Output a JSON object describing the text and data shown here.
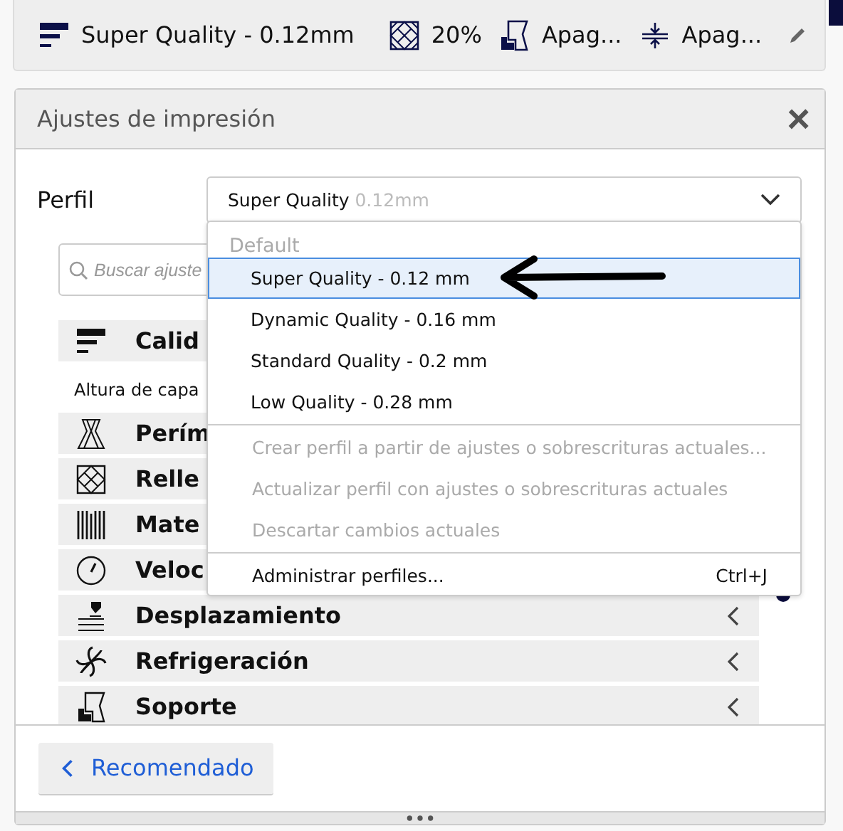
{
  "top_bar": {
    "profile": "Super Quality - 0.12mm",
    "infill": "20%",
    "support": "Apag...",
    "adhesion": "Apag..."
  },
  "panel": {
    "title": "Ajustes de impresión",
    "close": "×",
    "profile_label": "Perfil",
    "profile_combo": {
      "value": "Super Quality",
      "detail": "0.12mm"
    },
    "search": {
      "placeholder": "Buscar ajuste"
    },
    "categories": [
      {
        "name": "Calid",
        "settings": [
          {
            "label": "Altura de capa"
          }
        ]
      },
      {
        "name": "Perím"
      },
      {
        "name": "Relle"
      },
      {
        "name": "Mate"
      },
      {
        "name": "Veloc"
      },
      {
        "name": "Desplazamiento"
      },
      {
        "name": "Refrigeración"
      },
      {
        "name": "Soporte"
      }
    ],
    "footer_button": "Recomendado"
  },
  "dropdown": {
    "header": "Default",
    "profiles": [
      {
        "label": "Super Quality - 0.12 mm",
        "selected": true
      },
      {
        "label": "Dynamic Quality - 0.16 mm",
        "selected": false
      },
      {
        "label": "Standard Quality - 0.2 mm",
        "selected": false
      },
      {
        "label": "Low Quality - 0.28 mm",
        "selected": false
      }
    ],
    "action_groups": [
      {
        "items": [
          {
            "label": "Crear perfil a partir de ajustes o sobrescrituras actuales...",
            "disabled": true
          },
          {
            "label": "Actualizar perfil con ajustes o sobrescrituras actuales",
            "disabled": true
          },
          {
            "label": "Descartar cambios actuales",
            "disabled": true
          }
        ]
      },
      {
        "items": [
          {
            "label": "Administrar perfiles...",
            "shortcut": "Ctrl+J",
            "disabled": false
          }
        ]
      }
    ]
  }
}
